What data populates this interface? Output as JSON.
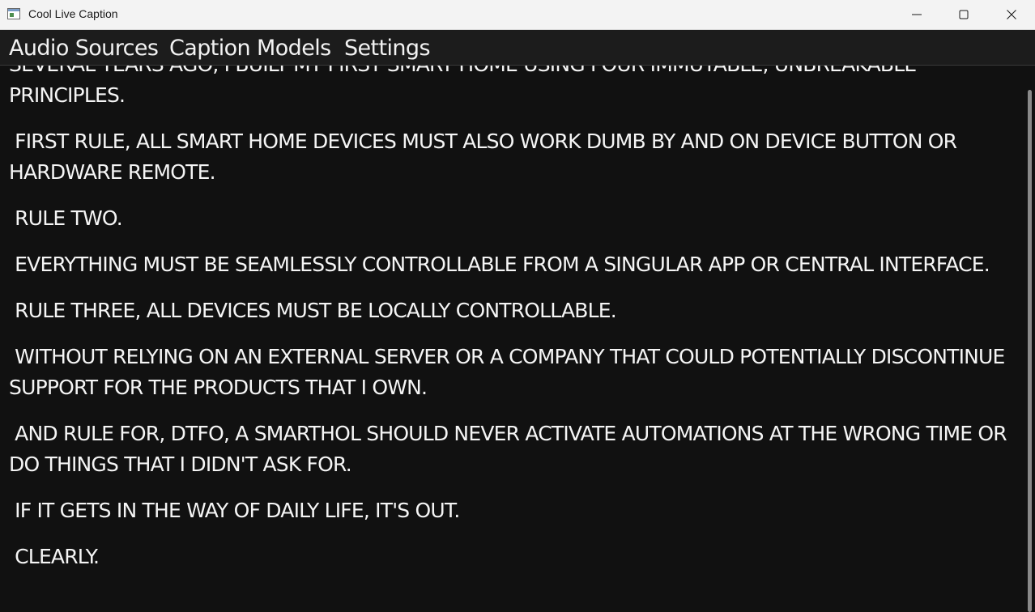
{
  "window": {
    "title": "Cool Live Caption"
  },
  "menu": {
    "items": [
      {
        "label": "Audio Sources"
      },
      {
        "label": "Caption Models"
      },
      {
        "label": "Settings"
      }
    ]
  },
  "captions": [
    "SEVERAL YEARS AGO, I BUILT MY FIRST SMART HOME USING FOUR IMMUTABLE, UNBREAKABLE PRINCIPLES.",
    " FIRST RULE, ALL SMART HOME DEVICES MUST ALSO WORK DUMB BY AND ON DEVICE BUTTON OR HARDWARE REMOTE.",
    " RULE TWO.",
    " EVERYTHING MUST BE SEAMLESSLY CONTROLLABLE FROM A SINGULAR APP OR CENTRAL INTERFACE.",
    " RULE THREE, ALL DEVICES MUST BE LOCALLY CONTROLLABLE.",
    " WITHOUT RELYING ON AN EXTERNAL SERVER OR A COMPANY THAT COULD POTENTIALLY DISCONTINUE SUPPORT FOR THE PRODUCTS THAT I OWN.",
    " AND RULE FOR, DTFO, A SMARTHOL SHOULD NEVER ACTIVATE AUTOMATIONS AT THE WRONG TIME OR DO THINGS THAT I DIDN'T ASK FOR.",
    " IF IT GETS IN THE WAY OF DAILY LIFE, IT'S OUT.",
    " CLEARLY."
  ],
  "icons": {
    "app": "app-window-icon",
    "minimize": "minimize-icon",
    "maximize": "maximize-icon",
    "close": "close-icon"
  },
  "colors": {
    "background": "#111111",
    "text": "#f5f5f5",
    "titlebar": "#f3f3f3",
    "menubar": "#1c1c1c"
  }
}
